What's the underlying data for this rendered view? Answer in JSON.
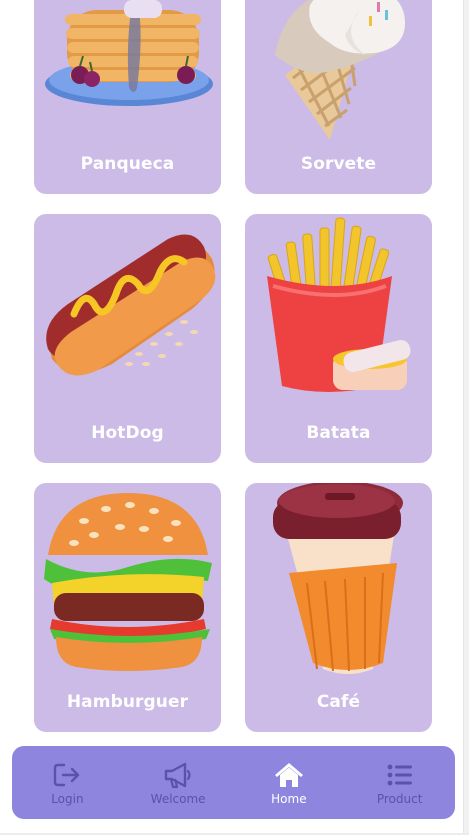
{
  "cards": [
    {
      "label": "Panqueca",
      "icon": "pancake-image"
    },
    {
      "label": "Sorvete",
      "icon": "ice-cream-image"
    },
    {
      "label": "HotDog",
      "icon": "hotdog-image"
    },
    {
      "label": "Batata",
      "icon": "fries-image"
    },
    {
      "label": "Hamburguer",
      "icon": "burger-image"
    },
    {
      "label": "Café",
      "icon": "coffee-cup-image"
    }
  ],
  "nav": {
    "items": [
      {
        "label": "Login",
        "icon": "login-icon",
        "active": false
      },
      {
        "label": "Welcome",
        "icon": "megaphone-icon",
        "active": false
      },
      {
        "label": "Home",
        "icon": "home-icon",
        "active": true
      },
      {
        "label": "Product",
        "icon": "list-icon",
        "active": false
      }
    ]
  },
  "colors": {
    "card_bg": "#cbbbe6",
    "nav_bg": "#8e85df",
    "nav_inactive": "#5a53a8",
    "nav_active": "#ffffff"
  }
}
